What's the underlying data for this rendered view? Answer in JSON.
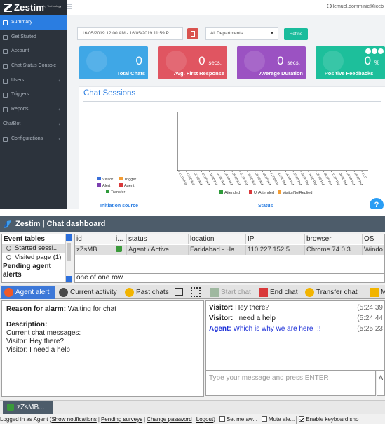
{
  "dashboard": {
    "brand": {
      "name": "Zestim",
      "by": "by Technology"
    },
    "user": "lemuel.domminic@iceb",
    "sidebar": [
      {
        "label": "Summary",
        "icon": "grid-icon",
        "active": true,
        "chevron": false
      },
      {
        "label": "Get Started",
        "icon": "rocket-icon",
        "active": false,
        "chevron": false
      },
      {
        "label": "Account",
        "icon": "account-icon",
        "active": false,
        "chevron": false
      },
      {
        "label": "Chat Status Console",
        "icon": "chat-icon",
        "active": false,
        "chevron": false
      },
      {
        "label": "Users",
        "icon": "users-icon",
        "active": false,
        "chevron": true
      },
      {
        "label": "Triggers",
        "icon": "trigger-icon",
        "active": false,
        "chevron": false
      },
      {
        "label": "Reports",
        "icon": "report-icon",
        "active": false,
        "chevron": true
      },
      {
        "label": "ChatBot",
        "icon": "",
        "active": false,
        "chevron": true
      },
      {
        "label": "Configurations",
        "icon": "gear-icon",
        "active": false,
        "chevron": true
      }
    ],
    "filters": {
      "date_range": "16/05/2019 12:00 AM - 16/05/2019 11:59 P",
      "department": "All Departments",
      "refine_label": "Refine"
    },
    "stats": [
      {
        "value": "0",
        "unit": "",
        "label": "Total Chats",
        "color": "#3fa7e6"
      },
      {
        "value": "0",
        "unit": "secs.",
        "label": "Avg. First Response",
        "color": "#e05561"
      },
      {
        "value": "0",
        "unit": "secs.",
        "label": "Average Duration",
        "color": "#9b52c2"
      },
      {
        "value": "0",
        "unit": "%",
        "label": "Positive Feedbacks",
        "color": "#1dbf9b"
      }
    ],
    "chat_sessions": {
      "title": "Chat Sessions",
      "source_legend": [
        {
          "label": "Visitor",
          "color": "#3a6fd8"
        },
        {
          "label": "Trigger",
          "color": "#f39c33"
        },
        {
          "label": "Alert",
          "color": "#7b3fb0"
        },
        {
          "label": "Agent",
          "color": "#d9383a"
        },
        {
          "label": "Transfer",
          "color": "#2e9a3a"
        }
      ],
      "status_legend": [
        {
          "label": "Attended",
          "color": "#2e9a3a"
        },
        {
          "label": "UnAttended",
          "color": "#d9383a"
        },
        {
          "label": "VisitorNotReplied",
          "color": "#f39c33"
        }
      ],
      "time_ticks": [
        "11:00 AM",
        "12:00 AM",
        "01:00 AM",
        "02:00 AM",
        "03:00 AM",
        "04:00 AM",
        "05:00 AM",
        "06:00 AM",
        "07:00 AM",
        "08:00 AM",
        "09:00 AM",
        "10:00 AM",
        "11:00 AM",
        "12:00 PM",
        "01:00 PM",
        "02:00 PM",
        "03:00 PM",
        "04:00 PM",
        "05:00 PM",
        "06:00 PM",
        "07:00 PM",
        "08:00 PM",
        "09:00 PM",
        "10:00 PM",
        "11:0"
      ],
      "initiation_label": "Initiation source",
      "status_label": "Status"
    },
    "help": "?"
  },
  "app": {
    "title": "Zestim | Chat dashboard",
    "event_tables_label": "Event tables",
    "tree_items": [
      {
        "label": "Started sessi...",
        "selected": true
      },
      {
        "label": "Visited page (1)",
        "selected": false
      }
    ],
    "pending_label": "Pending agent alerts",
    "grid": {
      "columns": [
        "id",
        "i...",
        "status",
        "location",
        "IP",
        "browser",
        "OS"
      ],
      "row": [
        "zZsMB...",
        "",
        "Agent / Active",
        "Faridabad - Ha...",
        "110.227.152.5",
        "Chrome 74.0.3...",
        "Windo"
      ],
      "footer": "one of one row"
    },
    "tabs": [
      {
        "label": "Agent alert",
        "active": true,
        "icon": "alert-icon"
      },
      {
        "label": "Current activity",
        "active": false,
        "icon": "activity-icon"
      },
      {
        "label": "Past chats",
        "active": false,
        "icon": "past-chats-icon"
      }
    ],
    "alert": {
      "reason_label": "Reason for alarm:",
      "reason_value": "Waiting for chat",
      "description_label": "Description:",
      "lines": [
        "Current chat messages:",
        "Visitor: Hey there?",
        "Visitor: I need a help"
      ]
    },
    "chat_toolbar": [
      {
        "label": "Start chat",
        "disabled": true,
        "icon": "start-chat-icon"
      },
      {
        "label": "End chat",
        "disabled": false,
        "icon": "end-chat-icon"
      },
      {
        "label": "Transfer chat",
        "disabled": false,
        "icon": "transfer-chat-icon"
      },
      {
        "label": "M",
        "disabled": false,
        "icon": "more-icon"
      }
    ],
    "messages": [
      {
        "who": "Visitor:",
        "text": "Hey there?",
        "time": "(5:24:39",
        "operator": false
      },
      {
        "who": "Visitor:",
        "text": "I need a help",
        "time": "(5:24:44",
        "operator": false
      },
      {
        "who": "Agent:",
        "text": "Which is why we are here !!!",
        "time": "(5:25:23",
        "operator": true
      }
    ],
    "input_placeholder": "Type your message and press ENTER",
    "input_aux": "A",
    "task_chip": "zZsMB...",
    "statusbar": {
      "prefix": "Logged in as Agent (",
      "links": [
        "Show notifications",
        "Pending surveys",
        "Change password",
        "Logout"
      ],
      "suffix": ")",
      "checks": [
        {
          "label": "Set me aw...",
          "checked": false
        },
        {
          "label": "Mute ale...",
          "checked": false
        },
        {
          "label": "Enable keyboard sho",
          "checked": true
        }
      ]
    }
  }
}
